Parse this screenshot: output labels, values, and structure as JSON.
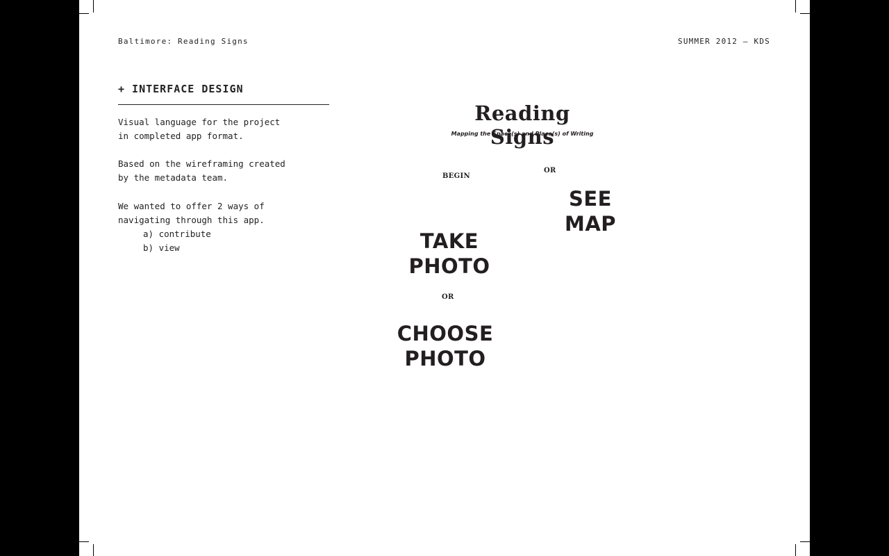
{
  "header": {
    "left": "Baltimore: Reading Signs",
    "right": "SUMMER 2012 – KDS"
  },
  "section": {
    "heading": "+ INTERFACE DESIGN",
    "para1_line1": "Visual language for the project",
    "para1_line2": "in completed app format.",
    "para2_line1": "Based on the wireframing created",
    "para2_line2": "by the metadata team.",
    "para3_line1": "We wanted to offer 2 ways of",
    "para3_line2": "navigating through this app.",
    "list": [
      "a) contribute",
      "b) view"
    ]
  },
  "mockup": {
    "title": "Reading Signs",
    "subtitle": "Mapping the Space(s) and Place(s) of Writing",
    "begin": "BEGIN",
    "or_top": "OR",
    "see_map_line1": "SEE",
    "see_map_line2": "MAP",
    "take_photo_line1": "TAKE",
    "take_photo_line2": "PHOTO",
    "or_bottom": "OR",
    "choose_photo_line1": "CHOOSE",
    "choose_photo_line2": "PHOTO"
  }
}
